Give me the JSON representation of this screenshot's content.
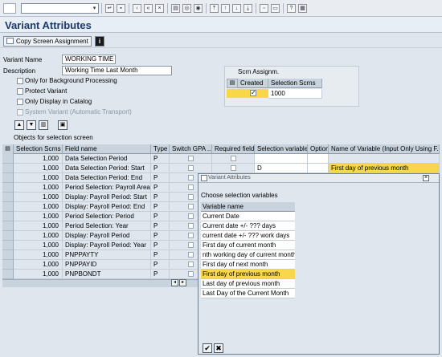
{
  "title": "Variant Attributes",
  "app_toolbar": {
    "copy_label": "Copy Screen Assignment",
    "info_label": "i"
  },
  "form": {
    "variant_name_label": "Variant Name",
    "variant_name_value": "WORKING TIME",
    "description_label": "Description",
    "description_value": "Working Time Last Month",
    "options": [
      {
        "label": "Only for Background Processing",
        "checked": false,
        "disabled": false
      },
      {
        "label": "Protect Variant",
        "checked": false,
        "disabled": false
      },
      {
        "label": "Only Display in Catalog",
        "checked": false,
        "disabled": false
      },
      {
        "label": "System Variant (Automatic Transport)",
        "checked": false,
        "disabled": true
      }
    ]
  },
  "scrn_assign": {
    "title": "Scrn Assignm.",
    "col_created": "Created",
    "col_selection": "Selection Scrns",
    "row_value": "1000"
  },
  "objects_label": "Objects for selection screen",
  "table": {
    "headers": [
      "Selection Scrns",
      "Field name",
      "Type",
      "Switch GPA ...",
      "Required field",
      "Selection variable",
      "Option",
      "Name of Variable (Input Only Using F..."
    ],
    "rows": [
      {
        "scr": "1,000",
        "field": "Data Selection Period",
        "type": "P",
        "selvar": "",
        "varname": ""
      },
      {
        "scr": "1,000",
        "field": "Data Selection Period: Start",
        "type": "P",
        "selvar": "D",
        "varname": "First day of previous month"
      },
      {
        "scr": "1,000",
        "field": "Data Selection Period: End",
        "type": "P",
        "selvar": "",
        "varname": ""
      },
      {
        "scr": "1,000",
        "field": "Period Selection: Payroll Area",
        "type": "P",
        "selvar": "",
        "varname": ""
      },
      {
        "scr": "1,000",
        "field": "Display: Payroll Period: Start",
        "type": "P",
        "selvar": "",
        "varname": ""
      },
      {
        "scr": "1,000",
        "field": "Display: Payroll Period: End",
        "type": "P",
        "selvar": "",
        "varname": ""
      },
      {
        "scr": "1,000",
        "field": "Period Selection: Period",
        "type": "P",
        "selvar": "",
        "varname": ""
      },
      {
        "scr": "1,000",
        "field": "Period Selection: Year",
        "type": "P",
        "selvar": "",
        "varname": ""
      },
      {
        "scr": "1,000",
        "field": "Display: Payroll Period",
        "type": "P",
        "selvar": "",
        "varname": ""
      },
      {
        "scr": "1,000",
        "field": "Display: Payroll Period: Year",
        "type": "P",
        "selvar": "",
        "varname": ""
      },
      {
        "scr": "1,000",
        "field": "PNPPAYTY",
        "type": "P",
        "selvar": "",
        "varname": ""
      },
      {
        "scr": "1,000",
        "field": "PNPPAYID",
        "type": "P",
        "selvar": "",
        "varname": ""
      },
      {
        "scr": "1,000",
        "field": "PNPBONDT",
        "type": "P",
        "selvar": "",
        "varname": ""
      }
    ]
  },
  "popup": {
    "title": "Variant Attributes",
    "heading": "Choose selection variables",
    "column": "Variable name",
    "items": [
      "Current Date",
      "Current date +/- ??? days",
      "current date +/- ??? work days",
      "First day of current month",
      "nth working day of current month",
      "First day of next month",
      "First day of previous month",
      "Last day of previous month",
      "Last Day of the Current Month"
    ],
    "selected_index": 6,
    "ok_label": "✔",
    "cancel_label": "✖"
  },
  "colors": {
    "highlight": "#f8d84a",
    "title": "#1c3a6e"
  }
}
